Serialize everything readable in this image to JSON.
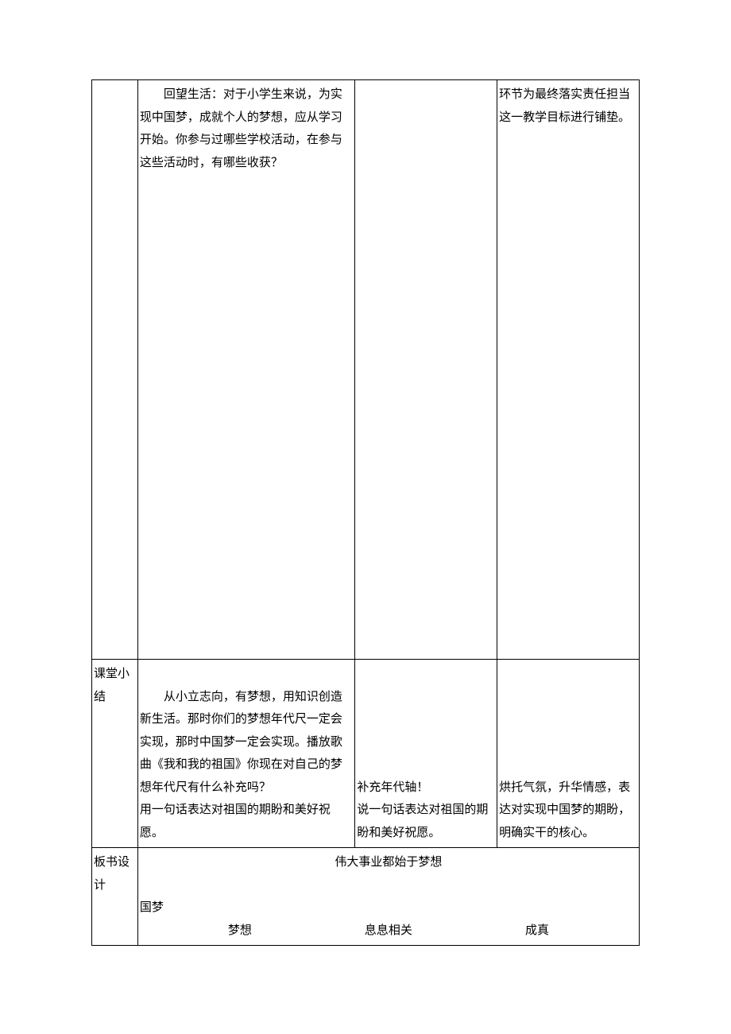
{
  "row1": {
    "label": "",
    "mainText": "回望生活：对于小学生来说，为实现中国梦，成就个人的梦想，应从学习开始。你参与过哪些学校活动，在参与这些活动时，有哪些收获？",
    "midText": "",
    "rightText": "环节为最终落实责任担当这一教学目标进行铺垫。"
  },
  "row2": {
    "label": "课堂小结",
    "mainPara1": "从小立志向，有梦想，用知识创造新生活。那时你们的梦想年代尺一定会实现，那时中国梦一定会实现。播放歌曲《我和我的祖国》你现在对自己的梦想年代尺有什么补充吗？",
    "mainPara2": "用一句话表达对祖国的期盼和美好祝愿。",
    "midLine1": "补充年代轴！",
    "midLine2": "说一句话表达对祖国的期盼和美好祝愿。",
    "rightLine1": "烘托气氛，升华情感，表达对实现中国梦的期盼，明确实干的核心。"
  },
  "row3": {
    "label": "板书设计",
    "title": "伟大事业都始于梦想",
    "line2": "国梦",
    "bottom": {
      "a": "梦想",
      "b": "息息相关",
      "c": "成真"
    }
  }
}
